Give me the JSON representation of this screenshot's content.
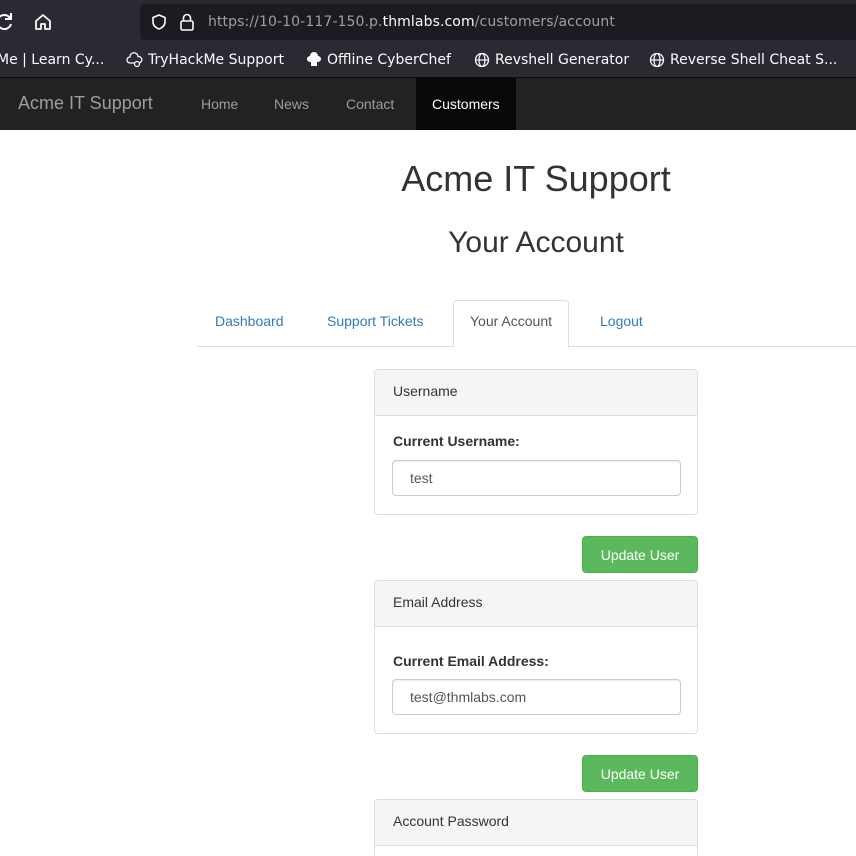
{
  "browser": {
    "url_prefix": "https://10-10-117-150.p.",
    "url_host": "thmlabs.com",
    "url_path": "/customers/account",
    "bookmarks": [
      {
        "label": "Me | Learn Cy...",
        "icon": "none"
      },
      {
        "label": "TryHackMe Support",
        "icon": "support-cloud-icon"
      },
      {
        "label": "Offline CyberChef",
        "icon": "chef-hat-icon"
      },
      {
        "label": "Revshell Generator",
        "icon": "globe-icon"
      },
      {
        "label": "Reverse Shell Cheat S...",
        "icon": "globe-icon"
      }
    ]
  },
  "navbar": {
    "brand": "Acme IT Support",
    "links": [
      "Home",
      "News",
      "Contact",
      "Customers"
    ],
    "active": "Customers",
    "colors": {
      "bg": "#222222",
      "active_bg": "#080808",
      "link": "#9d9d9d"
    }
  },
  "page": {
    "site_title": "Acme IT Support",
    "title": "Your Account"
  },
  "tabs": {
    "items": [
      "Dashboard",
      "Support Tickets",
      "Your Account",
      "Logout"
    ],
    "active": "Your Account"
  },
  "username_panel": {
    "heading": "Username",
    "label": "Current Username:",
    "value": "test",
    "button": "Update User"
  },
  "email_panel": {
    "heading": "Email Address",
    "label": "Current Email Address:",
    "value": "test@thmlabs.com",
    "button": "Update User"
  },
  "password_panel": {
    "heading": "Account Password"
  },
  "colors": {
    "link": "#337ab7",
    "success": "#5cb85c",
    "browser_chrome": "#2b2a33"
  }
}
